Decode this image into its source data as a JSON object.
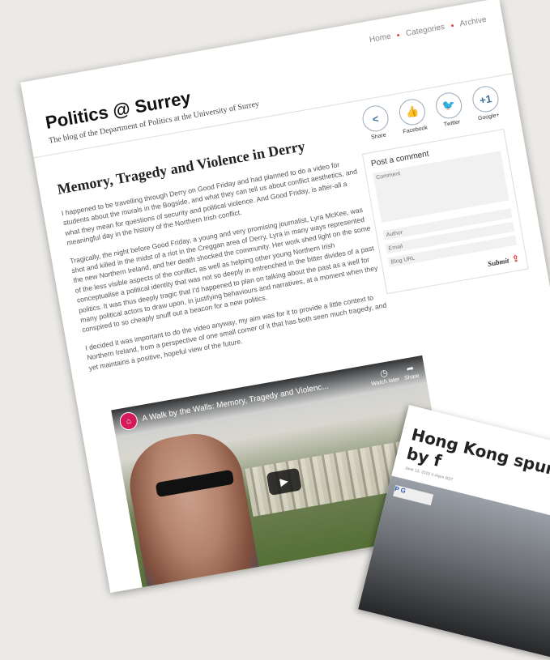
{
  "nav": {
    "items": [
      "Home",
      "Categories",
      "Archive"
    ]
  },
  "site": {
    "title": "Politics @ Surrey",
    "tagline": "The blog of the Department of Politics at the University of Surrey"
  },
  "share": [
    {
      "icon": "share-icon",
      "label": "Share",
      "glyph": "<"
    },
    {
      "icon": "facebook-like-icon",
      "label": "Facebook",
      "glyph": "👍"
    },
    {
      "icon": "twitter-bird-icon",
      "label": "Twitter",
      "glyph": "🐦"
    },
    {
      "icon": "google-plus-one-icon",
      "label": "Google+",
      "glyph": "+1"
    }
  ],
  "post": {
    "title": "Memory, Tragedy and Violence in Derry",
    "paragraphs": [
      "I happened to be travelling through Derry on Good Friday and had planned to do a video for students about the murals in the Bogside, and what they can tell us about conflict aesthetics, and what they mean for questions of security and political violence. And Good Friday, is after-all a meaningful day in the history of the Northern Irish conflict.",
      "Tragically, the night before Good Friday, a young and very promising journalist, Lyra McKee, was shot and killed in the midst of a riot in the Creggan area of Derry. Lyra in many ways represented the new Northern Ireland, and her death shocked the community. Her work shed light on the some of the less visible aspects of the conflict, as well as helping other young Northern Irish conceptualise a political identity that was not so deeply in entrenched in the bitter divides of a past politics. It was thus deeply tragic that I'd happened to plan on talking about the past as a well for many political actors to draw upon, in justifying behaviours and narratives, at a moment when they conspired to so cheaply snuff out a beacon for a new politics.",
      "I decided it was important to do the video anyway, my aim was for it to provide a little context to Northern Ireland, from a perspective of one small corner of it that has both seen much tragedy, and yet maintains a positive, hopeful view of the future."
    ]
  },
  "comment": {
    "title": "Post a comment",
    "comment_placeholder": "Comment",
    "author_placeholder": "Author",
    "email_placeholder": "Email",
    "url_placeholder": "Blog URL",
    "submit_label": "Submit"
  },
  "video": {
    "title": "A Walk by the Walls: Memory, Tragedy and Violenc...",
    "watch_later": "Watch later",
    "share": "Share"
  },
  "overlay_card": {
    "headline": "Hong Kong spurred by f",
    "date": "June 13, 2019 4.44pm BST",
    "sign_text": "P G"
  }
}
